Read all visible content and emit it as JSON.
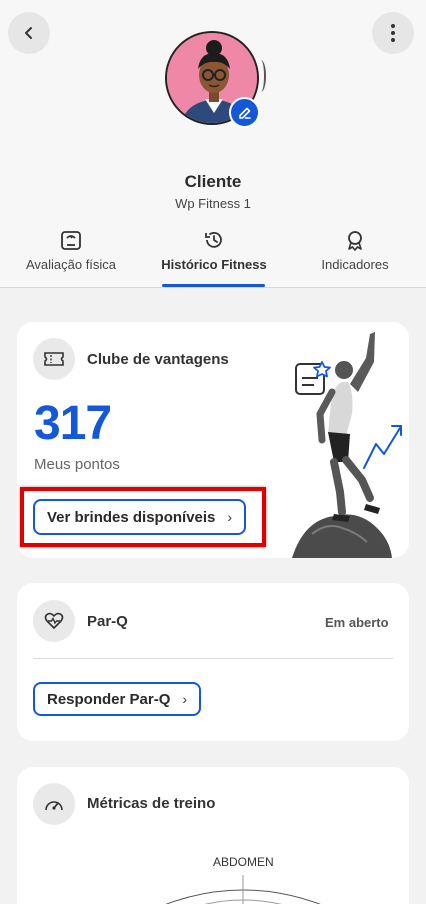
{
  "header": {
    "name": "Cliente",
    "company": "Wp Fitness 1"
  },
  "tabs": [
    {
      "label": "Avaliação física",
      "icon": "scale-icon"
    },
    {
      "label": "Histórico Fitness",
      "icon": "history-icon",
      "active": true
    },
    {
      "label": "Indicadores",
      "icon": "award-icon"
    }
  ],
  "rewards_card": {
    "title": "Clube de vantagens",
    "points": "317",
    "points_label": "Meus pontos",
    "button_label": "Ver brindes disponíveis",
    "chevron": "›"
  },
  "parq_card": {
    "title": "Par-Q",
    "status": "Em aberto",
    "button_label": "Responder Par-Q",
    "chevron": "›"
  },
  "metrics_card": {
    "title": "Métricas de treino",
    "radar_label": "ABDOMEN"
  },
  "colors": {
    "accent": "#1458d8",
    "highlight": "#e10000",
    "avatar_bg": "#ef87a6"
  }
}
